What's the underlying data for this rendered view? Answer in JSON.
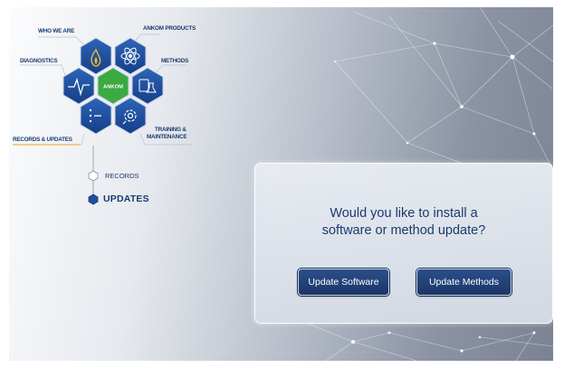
{
  "menu": {
    "who_we_are": "WHO WE ARE",
    "ankom_products": "ANKOM PRODUCTS",
    "diagnostics": "DIAGNOSTICS",
    "methods": "METHODS",
    "center_logo": "ANKOM",
    "records_updates": "RECORDS & UPDATES",
    "training_line1": "TRAINING &",
    "training_line2": "MAINTENANCE"
  },
  "submenu": {
    "records": "RECORDS",
    "updates": "UPDATES"
  },
  "dialog": {
    "question_line1": "Would you like to install a",
    "question_line2": "software or method update?",
    "update_software": "Update Software",
    "update_methods": "Update Methods"
  },
  "colors": {
    "navy": "#1a3a6e",
    "hex_blue": "#1f4e9c",
    "accent_green": "#38a640",
    "label_underline": "#f0a21b"
  }
}
